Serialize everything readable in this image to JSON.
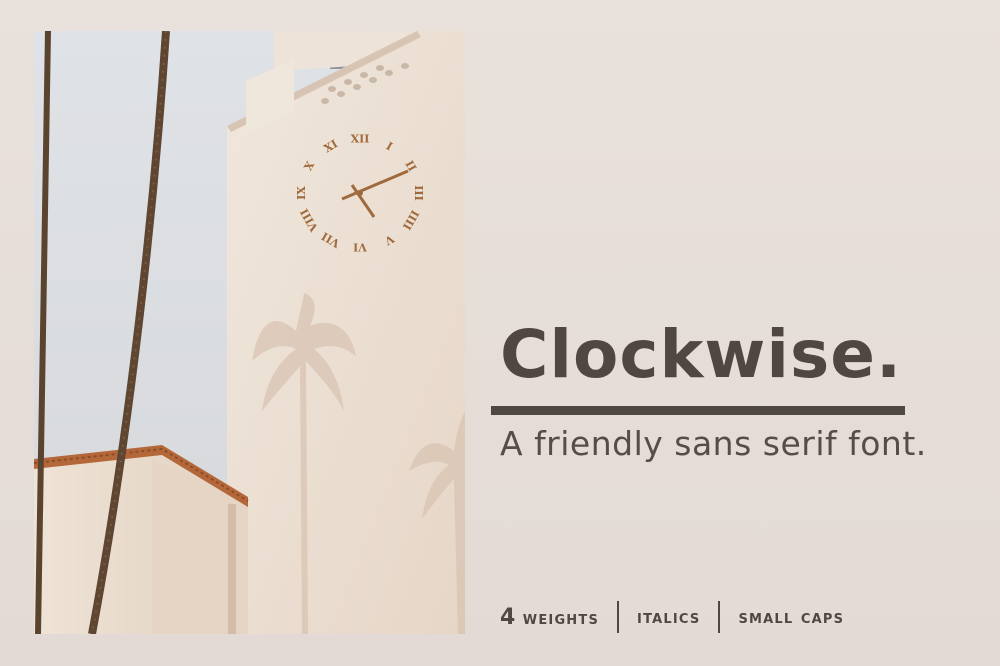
{
  "title": "Clockwise.",
  "subtitle": "A friendly sans serif font.",
  "features": {
    "weights_num": "4",
    "weights_word": "weights",
    "italics": "italics",
    "small_caps": "small caps"
  },
  "colors": {
    "background": "#e6ddd8",
    "text": "#514742",
    "wall": "#ece1d5",
    "sky": "#dde0e4",
    "roof_tile": "#b4683a",
    "clock_bronze": "#a06a3c"
  },
  "photo": {
    "clock_numerals": [
      "XII",
      "I",
      "II",
      "III",
      "IIII",
      "V",
      "VI",
      "VII",
      "VIII",
      "IX",
      "X",
      "XI"
    ]
  }
}
